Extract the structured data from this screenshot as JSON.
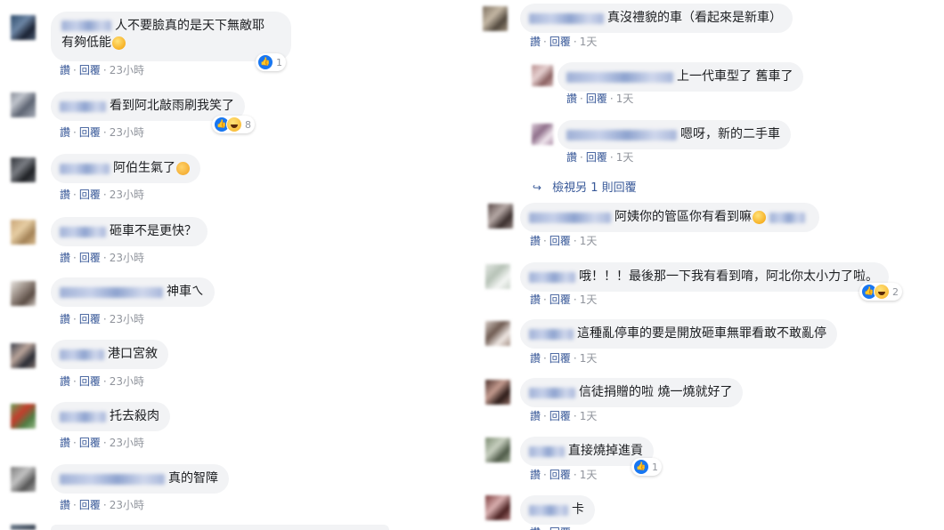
{
  "actions": {
    "like": "讚",
    "reply": "回覆",
    "sep": "·"
  },
  "left": [
    {
      "text": "人不要臉真的是天下無敵耶",
      "text2": "有夠低能",
      "time": "23小時",
      "reaction_count": "1"
    },
    {
      "text": "看到阿北敲雨刷我笑了",
      "time": "23小時",
      "reaction_count": "8"
    },
    {
      "text": "阿伯生氣了",
      "time": "23小時"
    },
    {
      "text": "砸車不是更快？",
      "time": "23小時"
    },
    {
      "text": "神車ㄟ",
      "time": "23小時"
    },
    {
      "text": "港口宮敘",
      "time": "23小時"
    },
    {
      "text": "托去殺肉",
      "time": "23小時"
    },
    {
      "text": "真的智障",
      "time": "23小時"
    }
  ],
  "right": [
    {
      "text": "真沒禮貌的車（看起來是新車）",
      "time": "1天"
    },
    {
      "text": "上一代車型了 舊車了",
      "time": "1天"
    },
    {
      "text": "嗯呀，新的二手車",
      "time": "1天"
    },
    {
      "view_more": "檢視另 1 則回覆"
    },
    {
      "text": "阿姨你的管區你有看到嘛",
      "time": "1天"
    },
    {
      "text": "哦！！！最後那一下我有看到唷，阿北你太小力了啦。",
      "time": "1天",
      "reaction_count": "2"
    },
    {
      "text": "這種亂停車的要是開放砸車無罪看敢不敢亂停",
      "time": "1天"
    },
    {
      "text": "信徒捐贈的啦 燒一燒就好了",
      "time": "1天"
    },
    {
      "text": "直接燒掉進貢",
      "time": "1天",
      "reaction_count": "1"
    },
    {
      "text": "卡"
    }
  ]
}
